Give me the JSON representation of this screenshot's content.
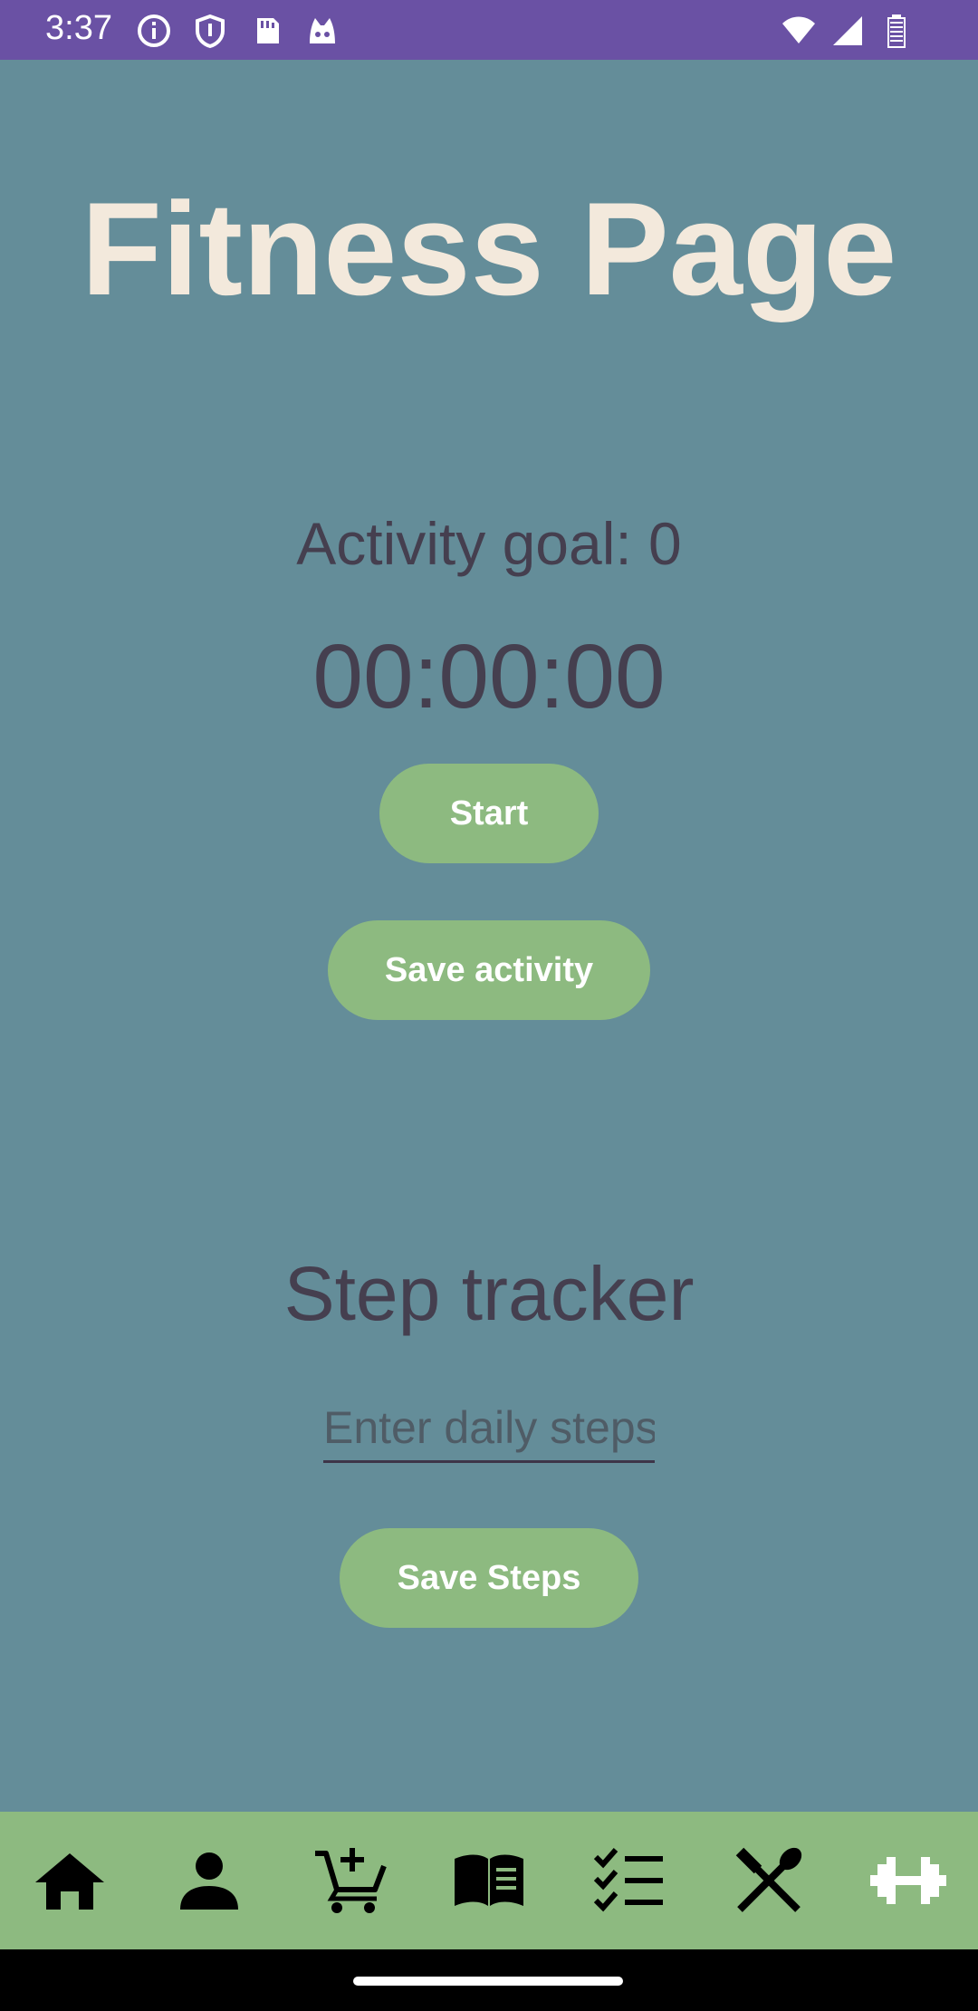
{
  "status_bar": {
    "time": "3:37",
    "icons_left": [
      "info-icon",
      "shield-icon",
      "sd-card-icon",
      "cat-face-icon"
    ],
    "icons_right": [
      "wifi-icon",
      "cell-signal-icon",
      "battery-icon"
    ],
    "background_color": "#6a51a4"
  },
  "page": {
    "title": "Fitness Page",
    "background_color": "#648d99"
  },
  "activity": {
    "goal_label": "Activity goal: 0",
    "timer": "00:00:00",
    "start_label": "Start",
    "save_label": "Save activity"
  },
  "steps": {
    "title": "Step tracker",
    "input_placeholder": "Enter daily steps",
    "input_value": "",
    "save_label": "Save Steps"
  },
  "bottom_nav": {
    "items": [
      "home-icon",
      "person-icon",
      "add-to-cart-icon",
      "book-icon",
      "checklist-icon",
      "utensils-icon",
      "dumbbell-icon"
    ],
    "active": "dumbbell-icon",
    "background_color": "#8dba80"
  },
  "colors": {
    "accent": "#8dba80",
    "title_text": "#f3e9dc",
    "body_text": "#453f4f"
  }
}
